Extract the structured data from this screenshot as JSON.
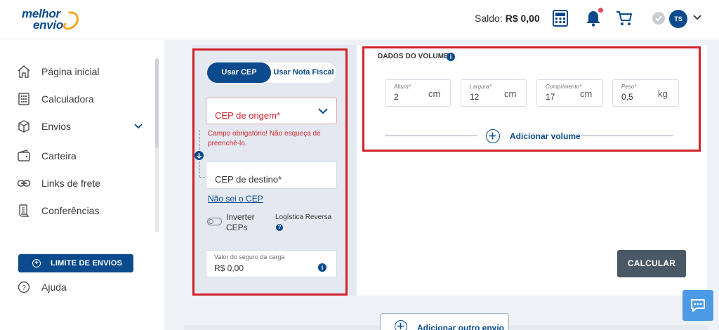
{
  "app": {
    "logo_line1": "melhor",
    "logo_line2": "envio"
  },
  "header": {
    "saldo_label": "Saldo:",
    "saldo_value": "R$ 0,00",
    "avatar_initials": "TS",
    "icons": [
      "calculator-icon",
      "bell-icon",
      "cart-icon",
      "verified-icon",
      "chevron-down-icon"
    ],
    "notification_color": "#e84a5f"
  },
  "sidebar": {
    "items": [
      {
        "label": "Página inicial",
        "icon": "home-icon"
      },
      {
        "label": "Calculadora",
        "icon": "calculator-icon"
      },
      {
        "label": "Envios",
        "icon": "box-icon"
      },
      {
        "label": "Carteira",
        "icon": "wallet-icon"
      },
      {
        "label": "Links de frete",
        "icon": "link-icon"
      },
      {
        "label": "Conferências",
        "icon": "document-icon"
      }
    ],
    "limit_button": "LIMITE DE ENVIOS",
    "help": "Ajuda"
  },
  "form": {
    "tab_active": "Usar CEP",
    "tab_inactive": "Usar Nota Fiscal",
    "origem_placeholder": "CEP de origem*",
    "origem_error": "Campo obrigatório! Não esqueça de preenchê-lo.",
    "destino_placeholder": "CEP de destino*",
    "nao_sei_cep": "Não sei o CEP",
    "inverter_line1": "Inverter",
    "inverter_line2": "CEPs",
    "logistica_reversa": "Logística Reversa",
    "seguro_label": "Valor do seguro da carga",
    "seguro_value": "R$ 0,00"
  },
  "volume": {
    "title": "DADOS DO VOLUME",
    "fields": [
      {
        "label": "Altura*",
        "value": "2",
        "unit": "cm"
      },
      {
        "label": "Largura*",
        "value": "12",
        "unit": "cm"
      },
      {
        "label": "Comprimento*",
        "value": "17",
        "unit": "cm"
      },
      {
        "label": "Peso*",
        "value": "0,5",
        "unit": "kg"
      }
    ],
    "add_volume": "Adicionar volume"
  },
  "actions": {
    "calcular": "CALCULAR",
    "adicionar_envio": "Adicionar outro envio"
  },
  "colors": {
    "brand": "#0b4a8c",
    "error": "#d2232a",
    "calc_button": "#4a5866",
    "chat_button": "#4d9be6"
  }
}
